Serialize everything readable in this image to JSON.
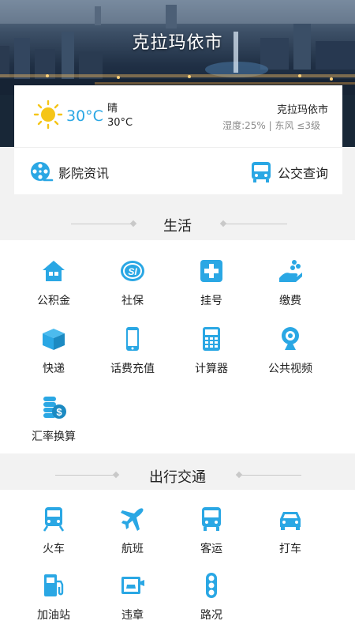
{
  "header": {
    "city_title": "克拉玛依市"
  },
  "weather": {
    "temperature": "30°C",
    "condition": "晴",
    "temp_range": "30°C",
    "city": "克拉玛依市",
    "details": "湿度:25% | 东风 ≤3级"
  },
  "quick_links": {
    "cinema_label": "影院资讯",
    "bus_label": "公交查询"
  },
  "sections": {
    "life": {
      "title": "生活",
      "items": [
        {
          "label": "公积金",
          "icon": "house-icon"
        },
        {
          "label": "社保",
          "icon": "social-security-icon"
        },
        {
          "label": "挂号",
          "icon": "medical-cross-icon"
        },
        {
          "label": "缴费",
          "icon": "payment-hand-icon"
        },
        {
          "label": "快递",
          "icon": "package-icon"
        },
        {
          "label": "话费充值",
          "icon": "phone-icon"
        },
        {
          "label": "计算器",
          "icon": "calculator-icon"
        },
        {
          "label": "公共视频",
          "icon": "webcam-icon"
        },
        {
          "label": "汇率换算",
          "icon": "coins-icon"
        }
      ]
    },
    "transport": {
      "title": "出行交通",
      "items": [
        {
          "label": "火车",
          "icon": "train-icon"
        },
        {
          "label": "航班",
          "icon": "plane-icon"
        },
        {
          "label": "客运",
          "icon": "bus-icon"
        },
        {
          "label": "打车",
          "icon": "taxi-icon"
        },
        {
          "label": "加油站",
          "icon": "gas-station-icon"
        },
        {
          "label": "违章",
          "icon": "traffic-camera-icon"
        },
        {
          "label": "路况",
          "icon": "traffic-light-icon"
        }
      ]
    }
  },
  "colors": {
    "accent": "#2aa7e4",
    "sun": "#f5c518",
    "divider": "#c9c9c9"
  }
}
